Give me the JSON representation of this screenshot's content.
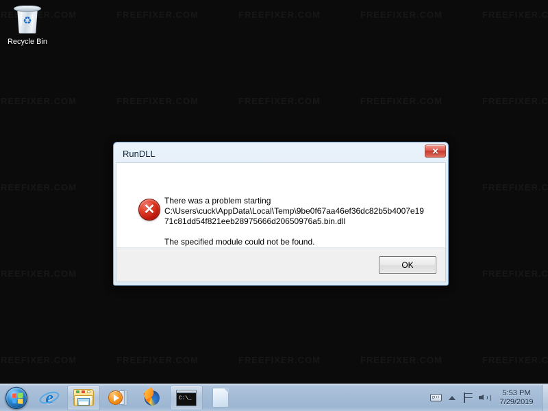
{
  "desktop": {
    "watermark_text": "FREEFIXER.COM",
    "background_color": "#0b0b0b",
    "icons": [
      {
        "name": "recycle-bin",
        "label": "Recycle Bin"
      }
    ]
  },
  "dialog": {
    "title": "RunDLL",
    "close_button_glyph": "✕",
    "error_icon_glyph": "✕",
    "message_lines": [
      "There was a problem starting",
      "C:\\Users\\cuck\\AppData\\Local\\Temp\\9be0f67aa46ef36dc82b5b4007e19",
      "71c81dd54f821eeb28975666d20650976a5.bin.dll"
    ],
    "secondary_message": "The specified module could not be found.",
    "ok_label": "OK",
    "titlebar_color": "#dceaf6",
    "close_button_color": "#c63a2e",
    "error_icon_color": "#c41a09"
  },
  "taskbar": {
    "background_color": "#a5bcd6",
    "start_button_name": "Start",
    "buttons": [
      {
        "name": "internet-explorer",
        "label": "Internet Explorer",
        "framed": false
      },
      {
        "name": "windows-explorer",
        "label": "Windows Explorer",
        "framed": true
      },
      {
        "name": "windows-media-player",
        "label": "Windows Media Player",
        "framed": false
      },
      {
        "name": "firefox",
        "label": "Mozilla Firefox",
        "framed": false
      },
      {
        "name": "command-prompt",
        "label": "Command Prompt",
        "framed": true
      },
      {
        "name": "document",
        "label": "Document",
        "framed": false
      }
    ],
    "tray": {
      "icons": [
        {
          "name": "tablet-input-panel-icon",
          "label": "Tablet PC Input Panel"
        },
        {
          "name": "show-hidden-icons-icon",
          "label": "Show hidden icons"
        },
        {
          "name": "action-center-flag-icon",
          "label": "Action Center"
        },
        {
          "name": "volume-speaker-icon",
          "label": "Volume"
        }
      ],
      "clock_time": "5:53 PM",
      "clock_date": "7/29/2019"
    }
  }
}
